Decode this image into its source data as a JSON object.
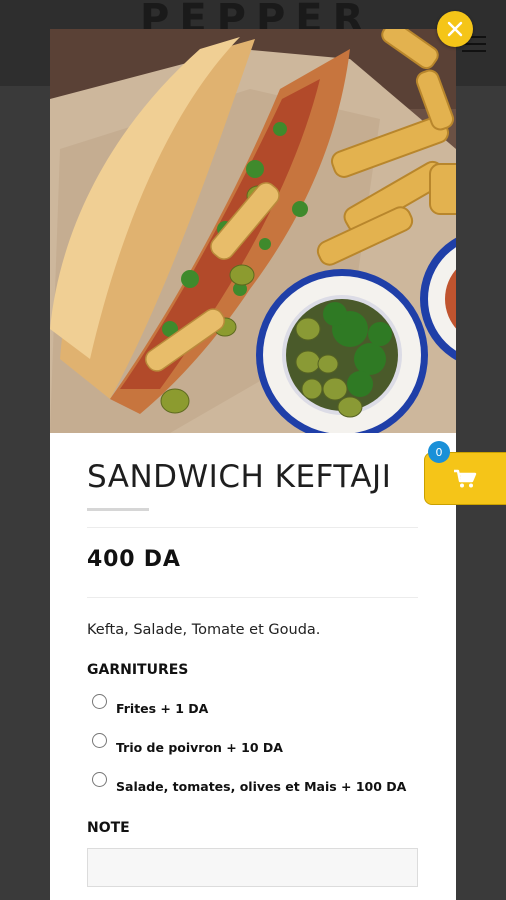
{
  "background": {
    "logo_text": "PEPPER"
  },
  "modal": {
    "title": "SANDWICH KEFTAJI",
    "price": "400 DA",
    "description": "Kefta, Salade, Tomate et Gouda.",
    "garnitures_label": "GARNITURES",
    "options": [
      {
        "label": "Frites + 1 DA",
        "checked": false
      },
      {
        "label": "Trio de poivron + 10 DA",
        "checked": false
      },
      {
        "label": "Salade, tomates, olives et Mais + 100 DA",
        "checked": false
      }
    ],
    "note_label": "NOTE",
    "note_value": ""
  },
  "cart": {
    "count": "0"
  },
  "colors": {
    "accent": "#f5c518",
    "badge": "#1a90d8",
    "text": "#1e1e1e"
  },
  "icons": {
    "close": "close-icon",
    "cart": "cart-icon",
    "menu": "hamburger-icon"
  }
}
